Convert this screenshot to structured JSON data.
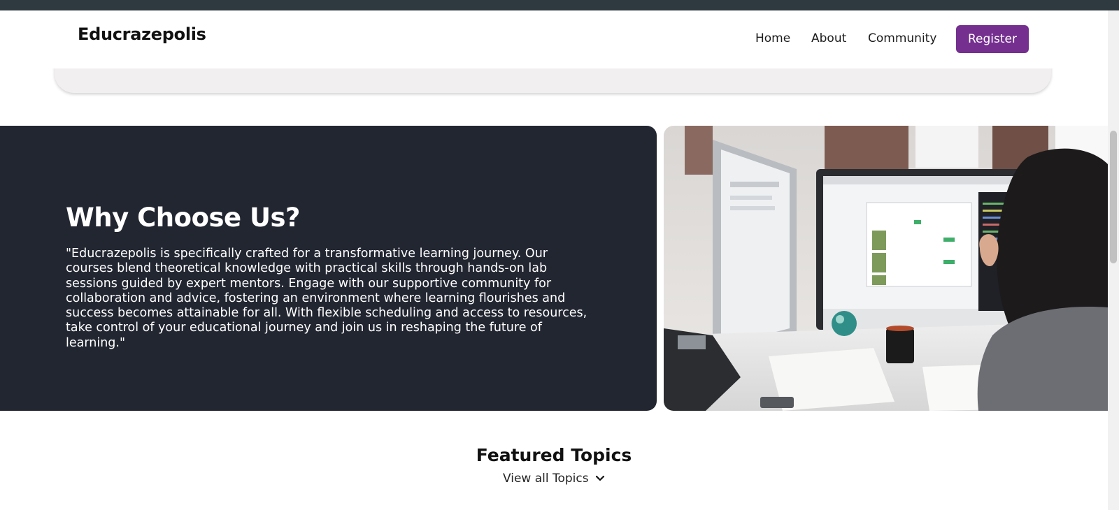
{
  "site": {
    "logo": "Educrazepolis"
  },
  "nav": {
    "home": "Home",
    "about": "About",
    "community": "Community",
    "register": "Register"
  },
  "why": {
    "title": "Why Choose Us?",
    "text": "\"Educrazepolis is specifically crafted for a transformative learning journey. Our courses blend theoretical knowledge with practical skills through hands-on lab sessions guided by expert mentors. Engage with our supportive community for collaboration and advice, fostering an environment where learning flourishes and success becomes attainable for all. With flexible scheduling and access to resources, take control of your educational journey and join us in reshaping the future of learning.\""
  },
  "featured": {
    "title": "Featured Topics",
    "view_all": "View all Topics"
  },
  "colors": {
    "brand": "#742f8f",
    "dark_panel": "#222631",
    "hero_card": "#f2eff0"
  },
  "icons": {
    "view_all": "chevron-down-icon"
  }
}
